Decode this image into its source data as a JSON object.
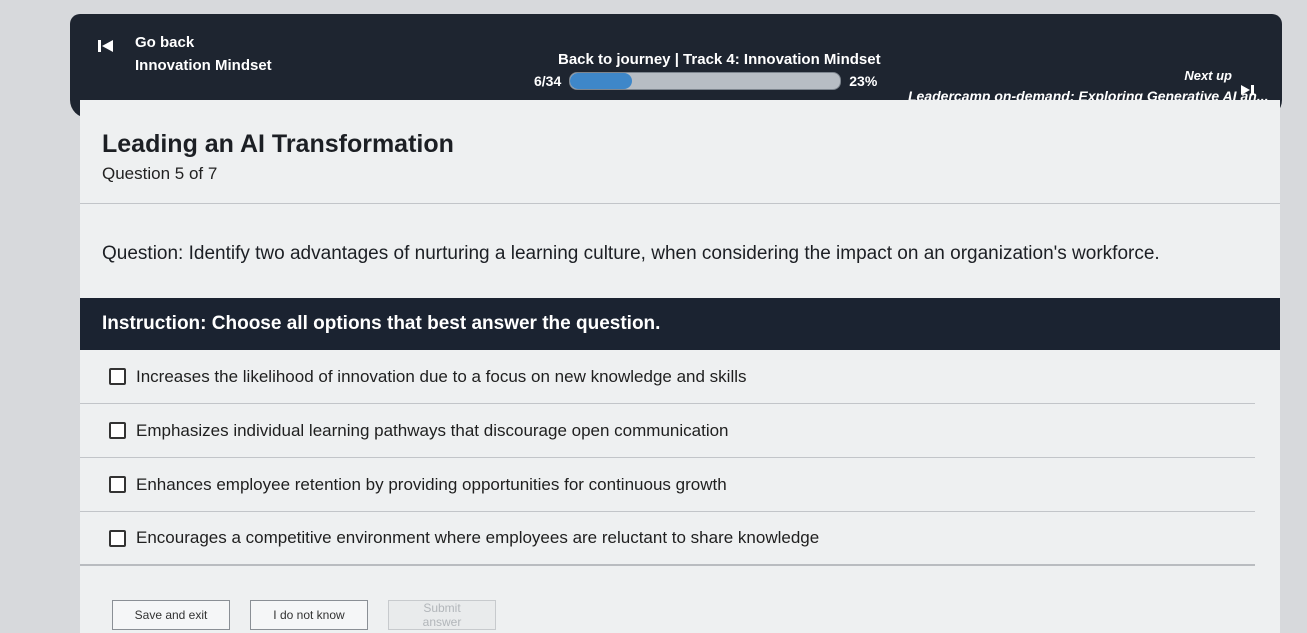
{
  "topbar": {
    "back_label": "Go back",
    "back_subtitle": "Innovation Mindset",
    "journey_link": "Back to journey  |  Track 4: Innovation Mindset",
    "progress_count": "6/34",
    "progress_percent_text": "23%",
    "progress_fraction": 0.23,
    "next_up_label": "Next up",
    "next_title": "Leadercamp on-demand: Exploring Generative AI an..."
  },
  "lesson": {
    "title": "Leading an AI Transformation",
    "question_count": "Question 5 of 7",
    "question": "Question: Identify two advantages of nurturing a learning culture, when considering the impact on an organization's workforce.",
    "instruction": "Instruction: Choose all options that best answer the question."
  },
  "options": [
    {
      "label": "Increases the likelihood of innovation due to a focus on new knowledge and skills",
      "checked": false
    },
    {
      "label": "Emphasizes individual learning pathways that discourage open communication",
      "checked": false
    },
    {
      "label": "Enhances employee retention by providing opportunities for continuous growth",
      "checked": false
    },
    {
      "label": "Encourages a competitive environment where employees are reluctant to share knowledge",
      "checked": false
    }
  ],
  "actions": {
    "save_exit": "Save and exit",
    "dont_know": "I do not know",
    "submit": "Submit answer"
  },
  "icons": {
    "back": "skip-back-icon",
    "next": "skip-forward-icon"
  },
  "colors": {
    "header_bg": "#1e2530",
    "progress_fill": "#3e87c9",
    "instruction_bg": "#1b2331"
  }
}
